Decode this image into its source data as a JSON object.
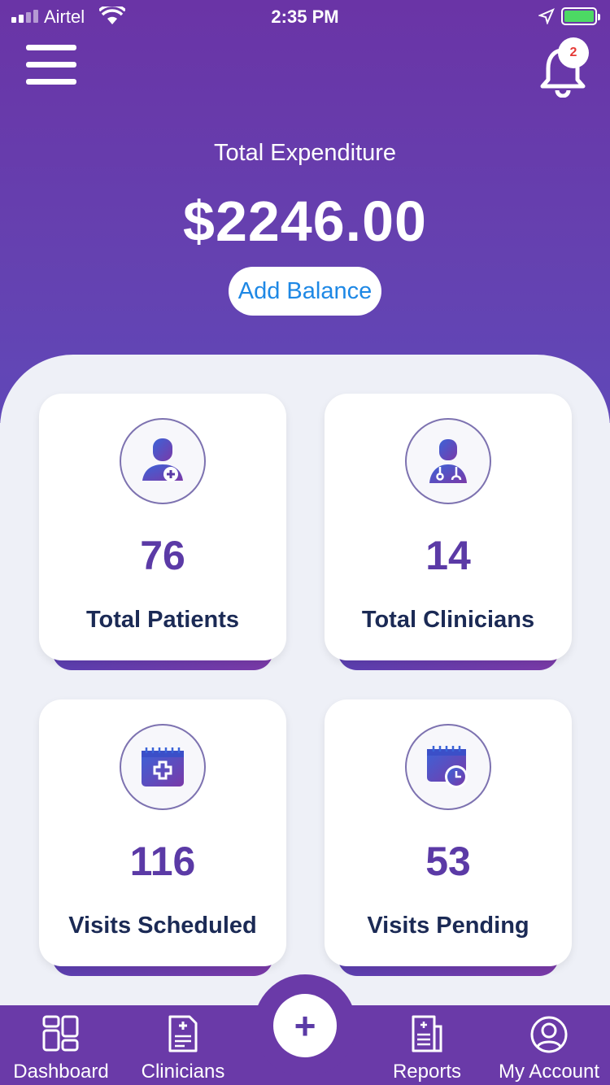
{
  "status_bar": {
    "carrier": "Airtel",
    "time": "2:35 PM"
  },
  "header": {
    "notification_count": "2",
    "expenditure_label": "Total Expenditure",
    "expenditure_amount": "$2246.00",
    "add_balance_label": "Add Balance"
  },
  "stats": [
    {
      "value": "76",
      "label": "Total Patients",
      "icon": "patient-icon"
    },
    {
      "value": "14",
      "label": "Total Clinicians",
      "icon": "doctor-icon"
    },
    {
      "value": "116",
      "label": "Visits Scheduled",
      "icon": "calendar-plus-icon"
    },
    {
      "value": "53",
      "label": "Visits Pending",
      "icon": "calendar-clock-icon"
    }
  ],
  "tabbar": {
    "dashboard": "Dashboard",
    "clinicians": "Clinicians",
    "add": "+",
    "reports": "Reports",
    "account": "My Account"
  },
  "colors": {
    "primary": "#6a3aa8",
    "accent_blue": "#1e88e5",
    "value_purple": "#5b3aa6",
    "label_navy": "#1b2a55"
  }
}
